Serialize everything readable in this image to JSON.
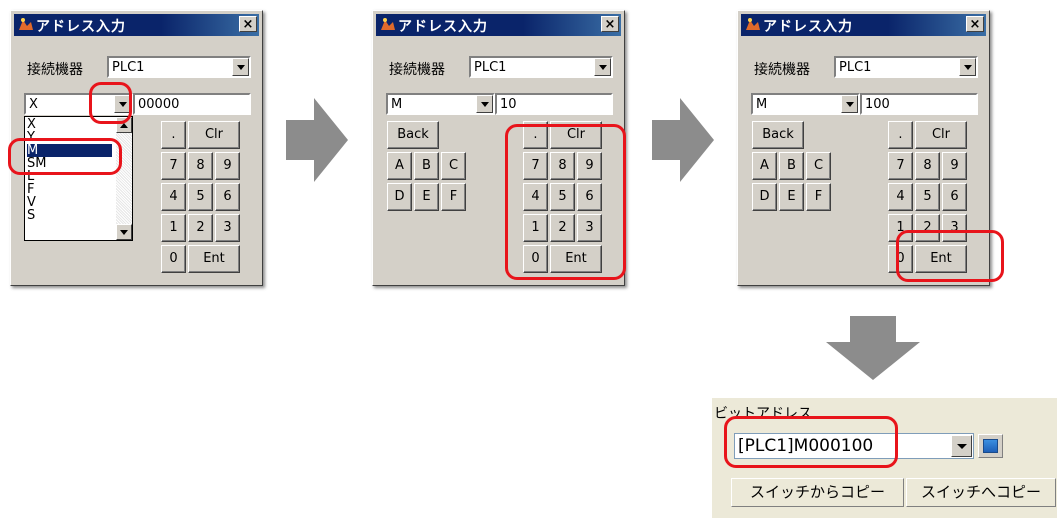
{
  "dialogs": [
    {
      "title": "アドレス入力",
      "device_label": "接続機器",
      "device_value": "PLC1",
      "type_value": "X",
      "address_value": "00000",
      "list_items": [
        "X",
        "Y",
        "M",
        "SM",
        "L",
        "F",
        "V",
        "S"
      ],
      "selected_item": "M"
    },
    {
      "title": "アドレス入力",
      "device_label": "接続機器",
      "device_value": "PLC1",
      "type_value": "M",
      "address_value": "10"
    },
    {
      "title": "アドレス入力",
      "device_label": "接続機器",
      "device_value": "PLC1",
      "type_value": "M",
      "address_value": "100"
    }
  ],
  "keypad": {
    "dot": ".",
    "clr": "Clr",
    "back": "Back",
    "hex": [
      "A",
      "B",
      "C",
      "D",
      "E",
      "F"
    ],
    "digits": [
      "7",
      "8",
      "9",
      "4",
      "5",
      "6",
      "1",
      "2",
      "3",
      "0"
    ],
    "ent": "Ent"
  },
  "close_glyph": "×",
  "result_panel": {
    "label": "ビットアドレス",
    "address_value": "[PLC1]M000100",
    "copy_from_switch": "スイッチからコピー",
    "copy_to_switch": "スイッチへコピー"
  },
  "colors": {
    "highlight": "#e8141b",
    "arrow": "#8c8c8c",
    "titlebar": "#0a246a",
    "dialog_bg": "#d4d0c8"
  }
}
